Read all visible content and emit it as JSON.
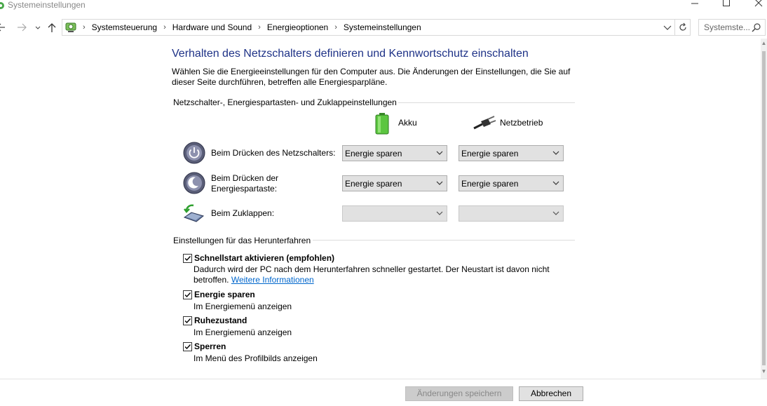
{
  "window": {
    "title": "Systemeinstellungen"
  },
  "nav": {
    "breadcrumbs": [
      "Systemsteuerung",
      "Hardware und Sound",
      "Energieoptionen",
      "Systemeinstellungen"
    ],
    "search_placeholder": "Systemste..."
  },
  "page": {
    "heading": "Verhalten des Netzschalters definieren und Kennwortschutz einschalten",
    "description": "Wählen Sie die Energieeinstellungen für den Computer aus. Die Änderungen der Einstellungen, die Sie auf dieser Seite durchführen, betreffen alle Energiesparpläne."
  },
  "buttons_section": {
    "title": "Netzschalter-, Energiespartasten- und Zuklappeinstellungen",
    "col_battery": "Akku",
    "col_plugged": "Netzbetrieb",
    "rows": [
      {
        "label": "Beim Drücken des Netzschalters:",
        "battery": "Energie sparen",
        "plugged": "Energie sparen"
      },
      {
        "label": "Beim Drücken der Energiespartaste:",
        "battery": "Energie sparen",
        "plugged": "Energie sparen"
      },
      {
        "label": "Beim Zuklappen:",
        "battery": "",
        "plugged": ""
      }
    ]
  },
  "shutdown_section": {
    "title": "Einstellungen für das Herunterfahren",
    "items": [
      {
        "label": "Schnellstart aktivieren (empfohlen)",
        "checked": true,
        "desc": "Dadurch wird der PC nach dem Herunterfahren schneller gestartet. Der Neustart ist davon nicht betroffen.",
        "link": "Weitere Informationen"
      },
      {
        "label": "Energie sparen",
        "checked": true,
        "desc": "Im Energiemenü anzeigen"
      },
      {
        "label": "Ruhezustand",
        "checked": true,
        "desc": "Im Energiemenü anzeigen"
      },
      {
        "label": "Sperren",
        "checked": true,
        "desc": "Im Menü des Profilbilds anzeigen"
      }
    ]
  },
  "footer": {
    "save_label": "Änderungen speichern",
    "cancel_label": "Abbrechen"
  },
  "colors": {
    "heading": "#1e3287",
    "link": "#0066cc"
  }
}
